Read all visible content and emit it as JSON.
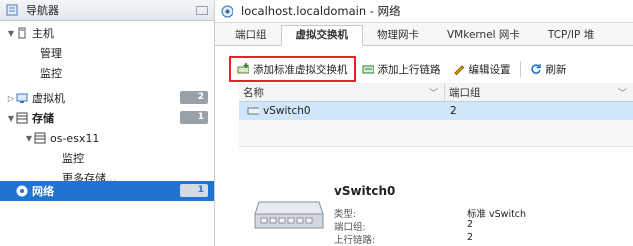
{
  "navigator": {
    "title": "导航器",
    "host": "主机",
    "manage": "管理",
    "monitor": "监控",
    "vms": "虚拟机",
    "vms_count": "2",
    "storage": "存储",
    "storage_count": "1",
    "datastore": "os-esx11",
    "ds_monitor": "监控",
    "more_storage": "更多存储...",
    "network": "网络",
    "network_count": "1"
  },
  "header": {
    "title": "localhost.localdomain - 网络"
  },
  "tabs": [
    "端口组",
    "虚拟交换机",
    "物理网卡",
    "VMkernel 网卡",
    "TCP/IP 堆"
  ],
  "toolbar": {
    "add_std_switch": "添加标准虚拟交换机",
    "add_uplink": "添加上行链路",
    "edit_settings": "编辑设置",
    "refresh": "刷新"
  },
  "grid": {
    "columns": [
      "名称",
      "端口组"
    ],
    "rows": [
      {
        "name": "vSwitch0",
        "portgroups": "2"
      }
    ]
  },
  "detail": {
    "name": "vSwitch0",
    "type_label": "类型:",
    "type_value": "标准 vSwitch",
    "portgroups_label": "端口组:",
    "portgroups_value": "2",
    "uplinks_label": "上行链路:",
    "uplinks_value": "2"
  },
  "colors": {
    "selection": "#1f74d1",
    "row_selected": "#cfe6fb",
    "highlight_border": "#e0262b"
  }
}
